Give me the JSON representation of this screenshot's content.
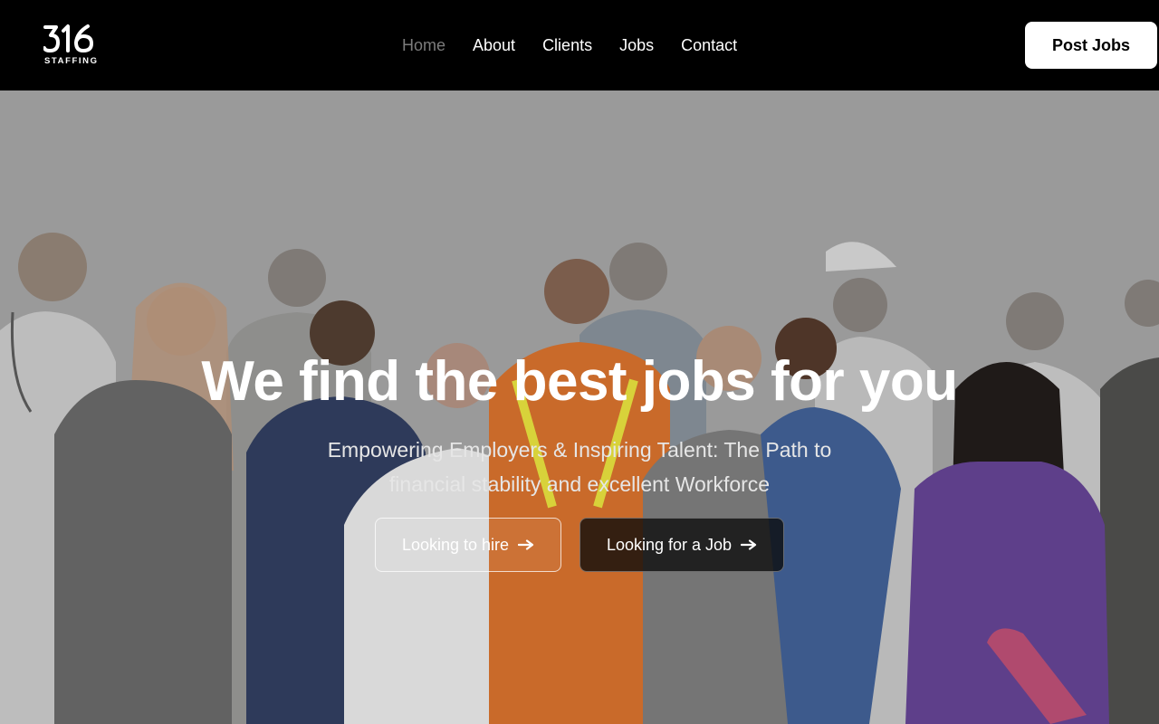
{
  "brand": {
    "logo_text": "316",
    "logo_sub": "STAFFING"
  },
  "nav": {
    "items": [
      {
        "label": "Home",
        "active": true
      },
      {
        "label": "About",
        "active": false
      },
      {
        "label": "Clients",
        "active": false
      },
      {
        "label": "Jobs",
        "active": false
      },
      {
        "label": "Contact",
        "active": false
      }
    ],
    "cta_label": "Post Jobs"
  },
  "hero": {
    "title": "We find the best jobs for you",
    "subtitle": "Empowering Employers & Inspiring Talent:  The Path to financial stability and excellent Workforce",
    "buttons": [
      {
        "label": "Looking to hire",
        "icon": "arrow-right-icon"
      },
      {
        "label": "Looking for a Job",
        "icon": "arrow-right-icon"
      }
    ],
    "image": "group-of-diverse-workers-photo"
  },
  "colors": {
    "nav_bg": "#000000",
    "nav_active": "#7c7c7c",
    "hero_bg": "#9a9a9a",
    "cta_bg": "#ffffff"
  }
}
